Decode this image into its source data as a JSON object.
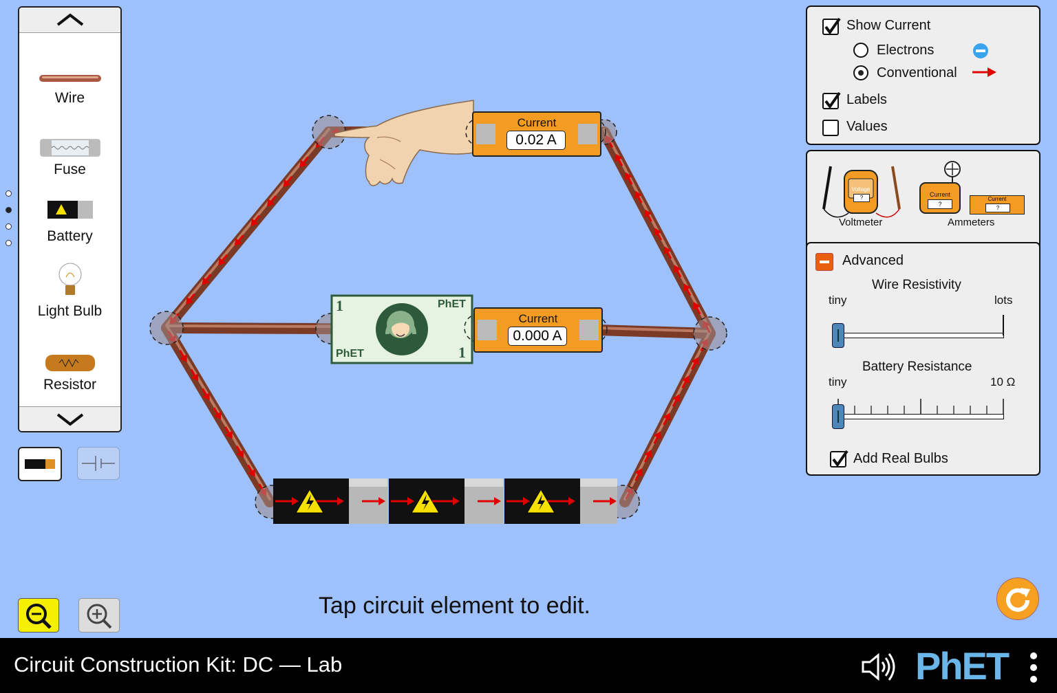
{
  "carousel": {
    "items": [
      {
        "label": "Wire",
        "icon": "wire-icon"
      },
      {
        "label": "Fuse",
        "icon": "fuse-icon"
      },
      {
        "label": "Battery",
        "icon": "battery-icon"
      },
      {
        "label": "Light Bulb",
        "icon": "light-bulb-icon"
      },
      {
        "label": "Resistor",
        "icon": "resistor-icon"
      }
    ],
    "page_count": 4,
    "current_page": 2
  },
  "view_toggle": {
    "selected": "lifelike"
  },
  "controls": {
    "show_current": {
      "label": "Show Current",
      "checked": true
    },
    "electrons": {
      "label": "Electrons",
      "selected": false
    },
    "conventional": {
      "label": "Conventional",
      "selected": true
    },
    "labels": {
      "label": "Labels",
      "checked": true
    },
    "values": {
      "label": "Values",
      "checked": false
    }
  },
  "sensors": {
    "voltmeter": {
      "label": "Voltmeter",
      "display": "Voltage",
      "reading": "?"
    },
    "ammeters": {
      "label": "Ammeters",
      "display": "Current",
      "reading": "?"
    }
  },
  "advanced": {
    "title": "Advanced",
    "expanded": true,
    "wire_resistivity": {
      "title": "Wire Resistivity",
      "min_label": "tiny",
      "max_label": "lots",
      "value": 0.0
    },
    "battery_resistance": {
      "title": "Battery Resistance",
      "min_label": "tiny",
      "max_label": "10 Ω",
      "value": 0.0
    },
    "add_real_bulbs": {
      "label": "Add Real Bulbs",
      "checked": true
    }
  },
  "circuit": {
    "top_ammeter": {
      "label": "Current",
      "value": "0.02 A"
    },
    "middle_ammeter": {
      "label": "Current",
      "value": "0.000 A"
    },
    "dollar_bill": {
      "corner_number": "1",
      "brand": "PhET"
    },
    "battery_count": 3
  },
  "hint": "Tap circuit element to edit.",
  "navbar": {
    "title": "Circuit Construction Kit: DC — Lab",
    "logo": "PhET"
  },
  "colors": {
    "background": "#9ec0fb",
    "accent": "#f39b23",
    "current_arrow": "#e00000",
    "navbar": "#000000"
  }
}
